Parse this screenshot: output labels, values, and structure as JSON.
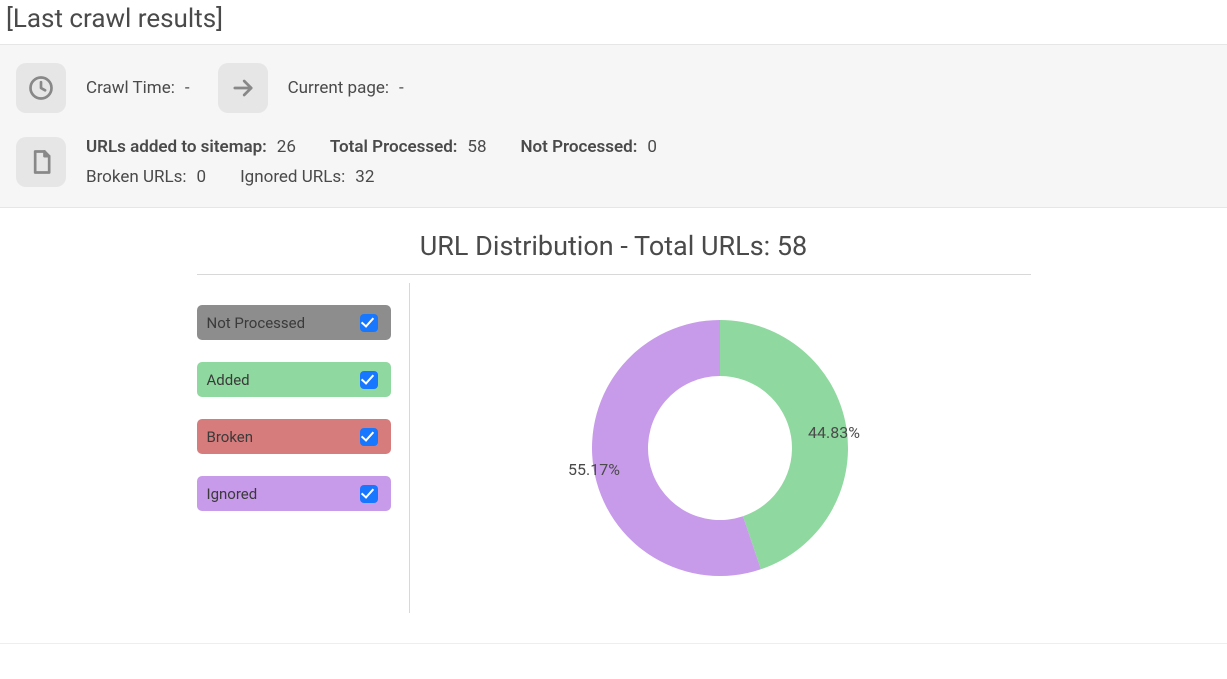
{
  "page_title": "[Last crawl results]",
  "crawl_info": {
    "crawl_time_label": "Crawl Time:",
    "crawl_time_value": "-",
    "current_page_label": "Current page:",
    "current_page_value": "-"
  },
  "stats": {
    "added_label": "URLs added to sitemap:",
    "added_value": "26",
    "total_label": "Total Processed:",
    "total_value": "58",
    "not_processed_label": "Not Processed:",
    "not_processed_value": "0",
    "broken_label": "Broken URLs:",
    "broken_value": "0",
    "ignored_label": "Ignored URLs:",
    "ignored_value": "32"
  },
  "chart_title": "URL Distribution - Total URLs: 58",
  "legend": {
    "not_processed": {
      "label": "Not Processed",
      "color": "#8d8d8d",
      "checked": true
    },
    "added": {
      "label": "Added",
      "color": "#8fd89f",
      "checked": true
    },
    "broken": {
      "label": "Broken",
      "color": "#d77c7c",
      "checked": true
    },
    "ignored": {
      "label": "Ignored",
      "color": "#c79aea",
      "checked": true
    }
  },
  "chart_data": {
    "type": "pie",
    "title": "URL Distribution - Total URLs: 58",
    "categories": [
      "Not Processed",
      "Added",
      "Broken",
      "Ignored"
    ],
    "values": [
      0,
      26,
      0,
      32
    ],
    "colors": [
      "#8d8d8d",
      "#8fd89f",
      "#d77c7c",
      "#c79aea"
    ],
    "percent_labels": {
      "added": "44.83%",
      "ignored": "55.17%"
    }
  }
}
